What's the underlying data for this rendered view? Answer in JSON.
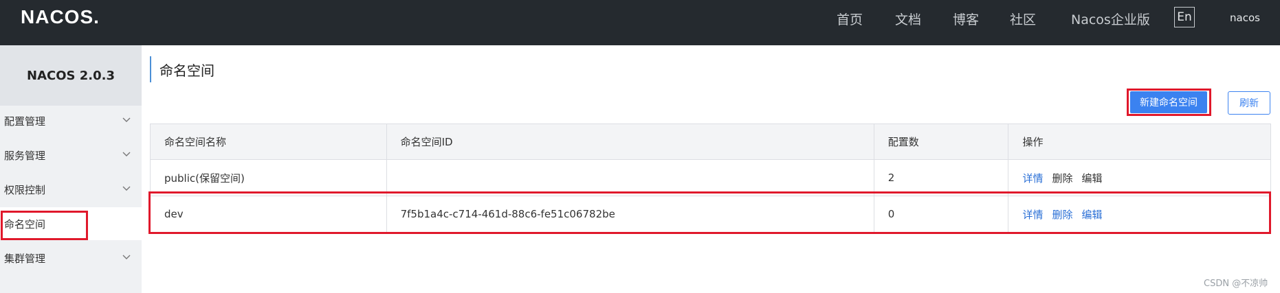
{
  "header": {
    "logo": "NACOS.",
    "nav": [
      "首页",
      "文档",
      "博客",
      "社区",
      "Nacos企业版"
    ],
    "lang": "En",
    "user": "nacos"
  },
  "sidebar": {
    "title": "NACOS 2.0.3",
    "items": [
      {
        "label": "配置管理"
      },
      {
        "label": "服务管理"
      },
      {
        "label": "权限控制"
      },
      {
        "label": "命名空间"
      },
      {
        "label": "集群管理"
      }
    ]
  },
  "main": {
    "title": "命名空间",
    "create_button": "新建命名空间",
    "refresh_button": "刷新",
    "table": {
      "headers": [
        "命名空间名称",
        "命名空间ID",
        "配置数",
        "操作"
      ],
      "rows": [
        {
          "name": "public(保留空间)",
          "id": "",
          "count": "2",
          "actions": [
            "详情",
            "删除",
            "编辑"
          ]
        },
        {
          "name": "dev",
          "id": "7f5b1a4c-c714-461d-88c6-fe51c06782be",
          "count": "0",
          "actions": [
            "详情",
            "删除",
            "编辑"
          ]
        }
      ]
    }
  },
  "watermark": "CSDN @不凉帅",
  "colors": {
    "topbar": "#252a2f",
    "primary": "#3b82f0",
    "highlight": "#e0182b",
    "link": "#2a6fd6"
  }
}
